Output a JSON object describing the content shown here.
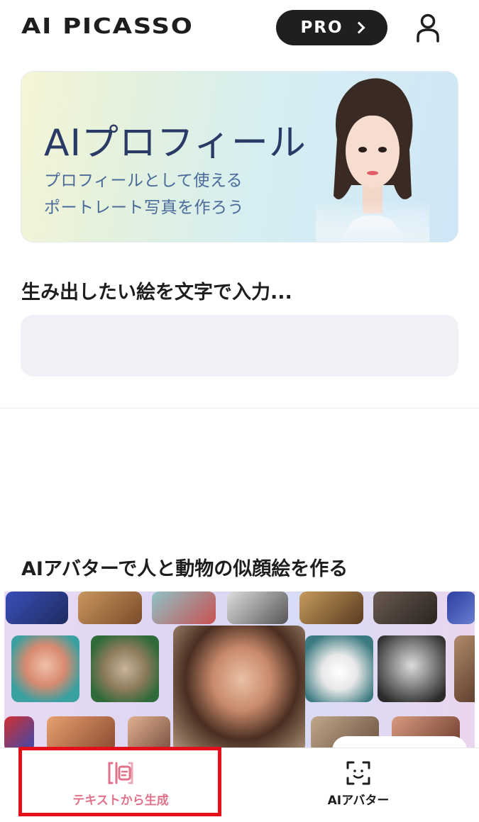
{
  "header": {
    "logo": "AI PICASSO",
    "pro_label": "PRO",
    "user_icon": "person-icon"
  },
  "banner": {
    "title": "AIプロフィール",
    "subtitle_line1": "プロフィールとして使える",
    "subtitle_line2": "ポートレート写真を作ろう"
  },
  "prompt": {
    "label": "生み出したい絵を文字で入力...",
    "value": "",
    "placeholder": ""
  },
  "avatar_section": {
    "title": "AIアバターで人と動物の似顔絵を作る"
  },
  "bottom_nav": {
    "items": [
      {
        "label": "テキストから生成",
        "icon": "text-generate-icon",
        "active": true,
        "color": "#e0728a"
      },
      {
        "label": "AIアバター",
        "icon": "face-scan-icon",
        "active": false,
        "color": "#1e1e1e"
      }
    ]
  },
  "colors": {
    "accent": "#e0728a",
    "highlight_box": "#e3101a",
    "pro_button": "#1f1f1f"
  }
}
